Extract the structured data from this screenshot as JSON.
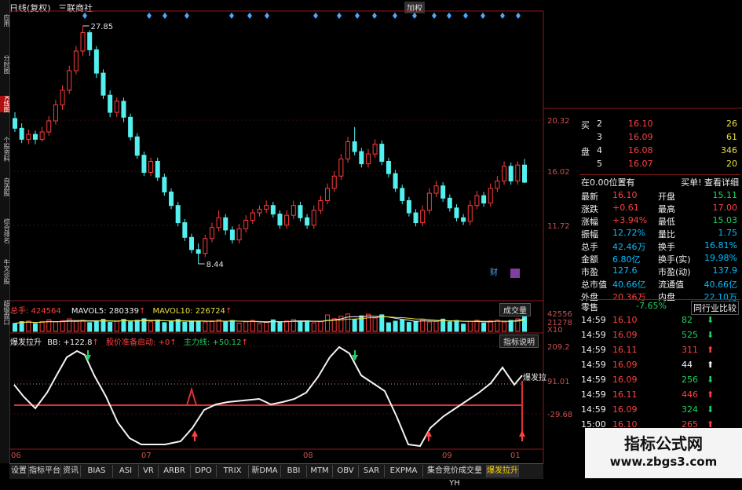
{
  "title": {
    "period": "日线(复权)",
    "stock_name": "三联商社"
  },
  "scale_button": "加权",
  "sidenav": [
    "应用",
    "分时图",
    "K线图",
    "个股资料",
    "自选股",
    "综合排名",
    "牛叉诊股",
    "超级盘口"
  ],
  "price_axis": [
    "20.32",
    "16.02",
    "11.72"
  ],
  "annotations": {
    "high": "27.85",
    "low": "8.44"
  },
  "vol_header": {
    "total": "总手: 424564",
    "ma5": "MAVOL5: 280339",
    "ma10": "MAVOL10: 226724",
    "button": "成交量"
  },
  "vol_axis": [
    "42556",
    "21278",
    "X10"
  ],
  "ind_header": {
    "name": "爆发拉升",
    "bb": "BB: +122.8",
    "signal": "股价准备启动: +0",
    "main": "主力线: +50.12",
    "button": "指标说明"
  },
  "ind_axis": [
    "209.2",
    "91.01",
    "-29.68"
  ],
  "ind_tag": "爆发拉",
  "date_axis": [
    "06",
    "07",
    "08",
    "09",
    "01"
  ],
  "order_book": [
    {
      "side": "买",
      "level": "2",
      "price": "16.10",
      "vol": "26"
    },
    {
      "side": "",
      "level": "3",
      "price": "16.09",
      "vol": "61"
    },
    {
      "side": "盘",
      "level": "4",
      "price": "16.08",
      "vol": "346"
    },
    {
      "side": "",
      "level": "5",
      "price": "16.07",
      "vol": "20"
    }
  ],
  "pos_row": {
    "left": "在0.00位置有",
    "right": "买单! 查看详细"
  },
  "quote": [
    {
      "l1": "最新",
      "v1": "16.10",
      "l2": "开盘",
      "v2": "15.11"
    },
    {
      "l1": "涨跌",
      "v1": "+0.61",
      "l2": "最高",
      "v2": "17.00"
    },
    {
      "l1": "涨幅",
      "v1": "+3.94%",
      "l2": "最低",
      "v2": "15.03"
    },
    {
      "l1": "振幅",
      "v1": "12.72%",
      "l2": "量比",
      "v2": "1.75"
    },
    {
      "l1": "总手",
      "v1": "42.46万",
      "l2": "换手",
      "v2": "16.81%"
    },
    {
      "l1": "金额",
      "v1": "6.80亿",
      "l2": "换手(实)",
      "v2": "19.98%"
    },
    {
      "l1": "市盈",
      "v1": "127.6",
      "l2": "市盈(动)",
      "v2": "137.9"
    },
    {
      "l1": "总市值",
      "v1": "40.66亿",
      "l2": "流通值",
      "v2": "40.66亿"
    },
    {
      "l1": "外盘",
      "v1": "20.36万",
      "l2": "内盘",
      "v2": "22.10万"
    }
  ],
  "sector": {
    "name": "零售",
    "change": "-7.65%",
    "button": "同行业比较"
  },
  "trades": [
    {
      "time": "14:59",
      "price": "16.10",
      "vol": "82",
      "dir": "down"
    },
    {
      "time": "14:59",
      "price": "16.09",
      "vol": "525",
      "dir": "down"
    },
    {
      "time": "14:59",
      "price": "16.11",
      "vol": "311",
      "dir": "up"
    },
    {
      "time": "14:59",
      "price": "16.09",
      "vol": "44",
      "dir": "up"
    },
    {
      "time": "14:59",
      "price": "16.09",
      "vol": "256",
      "dir": "down"
    },
    {
      "time": "14:59",
      "price": "16.11",
      "vol": "446",
      "dir": "up"
    },
    {
      "time": "14:59",
      "price": "16.09",
      "vol": "324",
      "dir": "down"
    },
    {
      "time": "15:00",
      "price": "16.10",
      "vol": "265",
      "dir": "up"
    }
  ],
  "tabs": [
    "设置",
    "指标平台",
    "资讯",
    "BIAS",
    "ASI",
    "VR",
    "ARBR",
    "DPO",
    "TRIX",
    "新DMA",
    "BBI",
    "MTM",
    "OBV",
    "SAR",
    "EXPMA",
    "集合竞价成交量YH",
    "爆发拉升"
  ],
  "watermark": {
    "line1": "指标公式网",
    "line2": "www.zbgs3.com"
  },
  "chart_data": {
    "type": "candlestick",
    "candles": [
      [
        20.3,
        19.5,
        20.8,
        19.2
      ],
      [
        19.5,
        18.6,
        19.9,
        18.3
      ],
      [
        18.6,
        19.0,
        19.4,
        18.2
      ],
      [
        19.0,
        18.6,
        19.3,
        18.2
      ],
      [
        18.6,
        19.2,
        19.6,
        18.4
      ],
      [
        19.2,
        20.1,
        20.5,
        18.9
      ],
      [
        20.1,
        21.4,
        21.8,
        19.8
      ],
      [
        21.4,
        22.6,
        23.0,
        21.0
      ],
      [
        22.6,
        24.2,
        24.6,
        22.3
      ],
      [
        24.2,
        25.8,
        26.2,
        23.9
      ],
      [
        25.8,
        27.3,
        27.85,
        25.4
      ],
      [
        27.3,
        25.9,
        27.5,
        25.4
      ],
      [
        25.9,
        24.0,
        26.2,
        23.6
      ],
      [
        24.0,
        22.2,
        24.3,
        21.9
      ],
      [
        22.2,
        20.8,
        22.6,
        20.4
      ],
      [
        20.8,
        21.7,
        22.0,
        20.4
      ],
      [
        21.7,
        20.4,
        22.0,
        20.0
      ],
      [
        20.4,
        18.8,
        20.7,
        18.5
      ],
      [
        18.8,
        17.3,
        19.1,
        17.0
      ],
      [
        17.3,
        15.9,
        17.6,
        15.6
      ],
      [
        15.9,
        16.8,
        17.1,
        15.6
      ],
      [
        16.8,
        15.5,
        17.1,
        15.2
      ],
      [
        15.5,
        14.3,
        15.8,
        14.0
      ],
      [
        14.3,
        13.2,
        14.6,
        12.9
      ],
      [
        13.2,
        11.8,
        13.5,
        11.5
      ],
      [
        11.8,
        10.6,
        12.1,
        10.3
      ],
      [
        10.6,
        9.6,
        10.9,
        9.3
      ],
      [
        9.6,
        9.3,
        10.1,
        8.44
      ],
      [
        9.3,
        10.5,
        10.8,
        9.0
      ],
      [
        10.5,
        11.4,
        11.8,
        10.2
      ],
      [
        11.4,
        12.2,
        12.8,
        11.1
      ],
      [
        12.2,
        11.2,
        12.5,
        10.8
      ],
      [
        11.2,
        10.4,
        11.5,
        10.1
      ],
      [
        10.4,
        11.3,
        11.7,
        10.1
      ],
      [
        11.3,
        12.0,
        12.4,
        11.0
      ],
      [
        12.0,
        12.6,
        12.9,
        11.7
      ],
      [
        12.6,
        12.9,
        13.2,
        12.3
      ],
      [
        12.9,
        13.2,
        13.6,
        12.6
      ],
      [
        13.2,
        12.5,
        13.5,
        12.2
      ],
      [
        12.5,
        11.6,
        12.8,
        11.3
      ],
      [
        11.6,
        12.4,
        12.8,
        11.3
      ],
      [
        12.4,
        13.2,
        13.6,
        12.1
      ],
      [
        13.2,
        12.2,
        13.5,
        11.9
      ],
      [
        12.2,
        11.6,
        12.5,
        11.3
      ],
      [
        11.6,
        12.8,
        13.2,
        11.3
      ],
      [
        12.8,
        13.6,
        14.0,
        12.5
      ],
      [
        13.6,
        14.6,
        15.0,
        13.3
      ],
      [
        14.6,
        15.6,
        16.0,
        14.3
      ],
      [
        15.6,
        17.0,
        17.4,
        15.3
      ],
      [
        17.0,
        18.4,
        18.8,
        16.7
      ],
      [
        18.4,
        17.6,
        19.6,
        17.3
      ],
      [
        17.6,
        16.6,
        17.9,
        16.3
      ],
      [
        16.6,
        17.4,
        17.8,
        16.3
      ],
      [
        17.4,
        18.2,
        18.6,
        17.1
      ],
      [
        18.2,
        16.8,
        18.5,
        16.5
      ],
      [
        16.8,
        15.8,
        17.1,
        15.5
      ],
      [
        15.8,
        14.6,
        16.1,
        14.3
      ],
      [
        14.6,
        13.6,
        14.9,
        13.3
      ],
      [
        13.6,
        12.6,
        13.9,
        12.3
      ],
      [
        12.6,
        11.8,
        12.9,
        11.5
      ],
      [
        11.8,
        12.8,
        13.2,
        11.5
      ],
      [
        12.8,
        14.2,
        14.6,
        12.5
      ],
      [
        14.2,
        14.8,
        15.2,
        13.9
      ],
      [
        14.8,
        13.8,
        15.1,
        13.5
      ],
      [
        13.8,
        13.0,
        14.1,
        12.7
      ],
      [
        13.0,
        12.2,
        13.3,
        11.9
      ],
      [
        12.2,
        11.9,
        12.5,
        11.6
      ],
      [
        11.9,
        13.2,
        13.6,
        11.6
      ],
      [
        13.2,
        14.0,
        14.4,
        12.9
      ],
      [
        14.0,
        13.4,
        14.3,
        13.1
      ],
      [
        13.4,
        14.6,
        15.0,
        13.1
      ],
      [
        14.6,
        15.2,
        15.6,
        14.3
      ],
      [
        15.2,
        16.4,
        16.8,
        14.9
      ],
      [
        16.4,
        15.2,
        16.7,
        14.9
      ],
      [
        15.2,
        16.5,
        16.8,
        14.9
      ],
      [
        16.5,
        15.1,
        17.0,
        15.03
      ]
    ],
    "volume_max": 425564,
    "vol_ylim": [
      0,
      425560
    ]
  }
}
